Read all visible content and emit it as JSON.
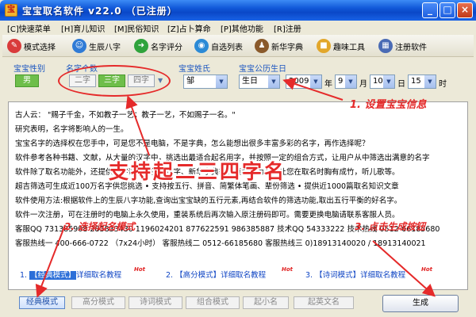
{
  "window": {
    "title": "宝宝取名软件 v22.0 （已注册）",
    "icon_glyph": "宝"
  },
  "menu": [
    "[C]快速菜单",
    "[H]育儿知识",
    "[M]民俗知识",
    "[Z]占卜算命",
    "[P]其他功能",
    "[R]注册"
  ],
  "toolbar": [
    {
      "label": "模式选择",
      "icon": "palette-icon",
      "glyph": "✎",
      "color": "#d93b3b"
    },
    {
      "label": "生辰八字",
      "icon": "people-icon",
      "glyph": "☺",
      "color": "#2f7bd6"
    },
    {
      "label": "名字评分",
      "icon": "arrow-icon",
      "glyph": "➜",
      "color": "#2fa33c"
    },
    {
      "label": "自选列表",
      "icon": "globe-icon",
      "glyph": "◉",
      "color": "#2b8ad6"
    },
    {
      "label": "新华字典",
      "icon": "teacher-icon",
      "glyph": "♟",
      "color": "#8a5a2b"
    },
    {
      "label": "趣味工具",
      "icon": "windows-icon",
      "glyph": "■",
      "color": "#e2a72c"
    },
    {
      "label": "注册软件",
      "icon": "register-icon",
      "glyph": "▦",
      "color": "#4a6bb5"
    }
  ],
  "options": {
    "gender_title": "宝宝性别",
    "gender_value": "男",
    "name_count_title": "名字个数",
    "name_counts": [
      "二字",
      "三字",
      "四字"
    ],
    "name_count_selected": 1,
    "surname_title": "宝宝姓氏",
    "surname_value": "邹",
    "birth_title": "宝宝公历生日",
    "birth": [
      {
        "value": "生日",
        "unit": ""
      },
      {
        "value": "2009",
        "unit": "年"
      },
      {
        "value": "9",
        "unit": "月"
      },
      {
        "value": "10",
        "unit": "日"
      },
      {
        "value": "15",
        "unit": "时"
      }
    ]
  },
  "content": {
    "lines": [
      "古人云：   \"赐子千金，不如教子一艺；教子一艺，不如赐子一名。\"",
      "研究表明，名字将影响人的一生。",
      "宝宝名字的选择权在您手中，可是您不是电脑，不是字典，怎么能想出很多丰富多彩的名字，再作选择呢？",
      "软件参考各种书籍、文献，从大量的汉字中，挑选出最适合起名用字，并按照一定的组合方式，让用户从中筛选出满意的名字",
      "软件除了取名功能外，还提供名字评分、生辰八字、新华字典等多项实用功能，让您在取名时胸有成竹，听儿歌等。",
      "超吉筛选可生成近100万名字供您挑选   •  支持按五行、拼音、简繁体笔画、辈份筛选   •  提供近1000篇取名知识文章",
      "软件使用方法:根据软件上的生辰八字功能,查询出宝宝缺的五行元素,再结合软件的筛选功能,取出五行平衡的好名字。",
      "软件一次注册，可在注册时的电脑上永久使用，重装系统后再次输入原注册码即可。需要更换电脑请联系客服人员。",
      "客服QQ 731385908  283833430  1196024201  877622591  986385887    技术QQ 54333222    技术热线 0512-66185680",
      "客服热线一 400-666-0722 （7x24小时）   客服热线二 0512-66185680       客服热线三 0)18913140020 / 18913140021"
    ],
    "links": [
      {
        "num": "1.",
        "mode": "【经典模式】",
        "rest": "详细取名教程"
      },
      {
        "num": "2.",
        "mode": "【高分模式】",
        "rest": "详细取名教程"
      },
      {
        "num": "3.",
        "mode": "【诗词模式】",
        "rest": "详细取名教程"
      }
    ],
    "hot_label": "Hot"
  },
  "annotations": {
    "set_info": "1. 设置宝宝信息",
    "support": "支持起二三四字名",
    "choose_mode": "2. 选择起名模式",
    "click_generate": "3. 点击生成按钮"
  },
  "modes": [
    "经典模式",
    "高分模式",
    "诗词模式",
    "组合模式",
    "起小名",
    "起英文名"
  ],
  "modes_selected": 0,
  "generate_label": "生成",
  "colors": {
    "accent": "#e52a2a",
    "link": "#1046c4",
    "active_green": "#6ebe4a"
  }
}
